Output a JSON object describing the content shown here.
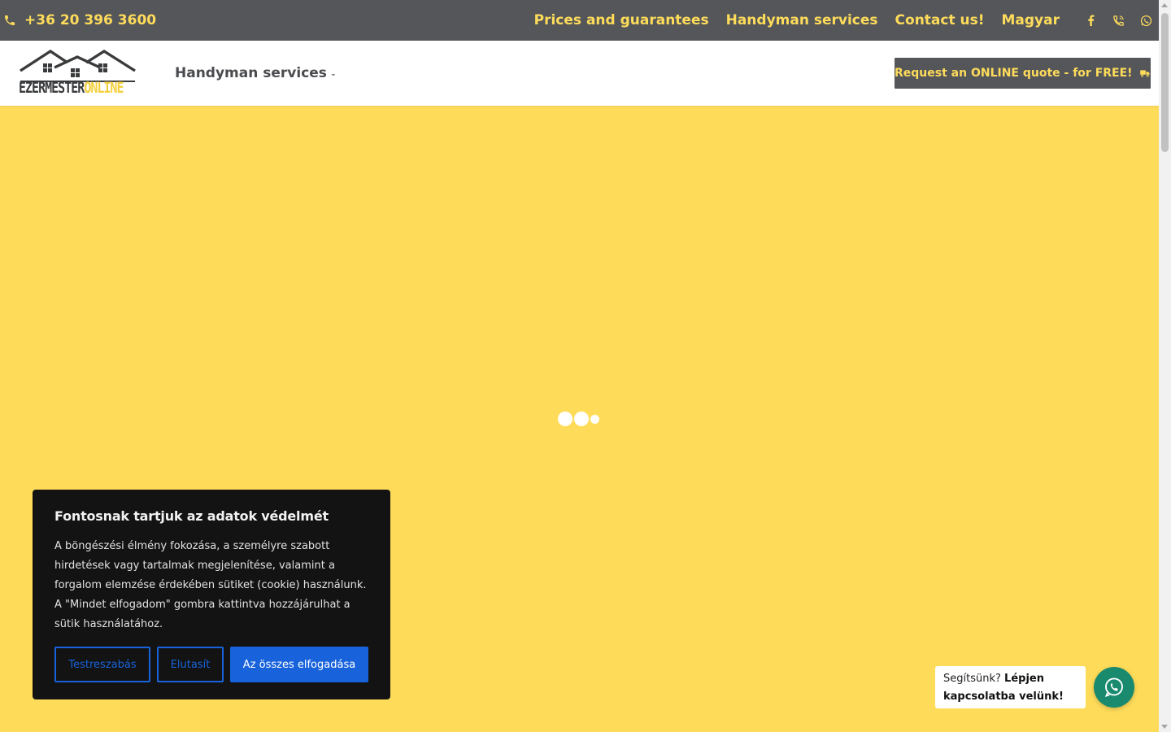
{
  "topbar": {
    "phone": "+36 20 396 3600",
    "nav": [
      {
        "label": "Prices and guarantees"
      },
      {
        "label": "Handyman services"
      },
      {
        "label": "Contact us!"
      },
      {
        "label": "Magyar"
      }
    ],
    "social": [
      "facebook-icon",
      "viber-icon",
      "whatsapp-icon"
    ]
  },
  "header": {
    "logo": {
      "part1": "EZERMESTER",
      "part2": "ONLINE"
    },
    "menu_label": "Handyman services",
    "cta_label": "Request an ONLINE quote - for FREE!"
  },
  "cookie": {
    "title": "Fontosnak tartjuk az adatok védelmét",
    "body": "A böngészési élmény fokozása, a személyre szabott hirdetések vagy tartalmak megjelenítése, valamint a forgalom elemzése érdekében sütiket (cookie) használunk. A \"Mindet elfogadom\" gombra kattintva hozzájárulhat a sütik használatához.",
    "customize": "Testreszabás",
    "reject": "Elutasít",
    "accept_all": "Az összes elfogadása"
  },
  "whatsapp": {
    "text_plain": "Segítsünk? ",
    "text_bold": "Lépjen kapcsolatba velünk!"
  },
  "colors": {
    "brand_yellow": "#fedc5a",
    "dark_gray": "#54565a",
    "cookie_blue": "#1863dc",
    "whatsapp_green": "#1a8a6f"
  }
}
